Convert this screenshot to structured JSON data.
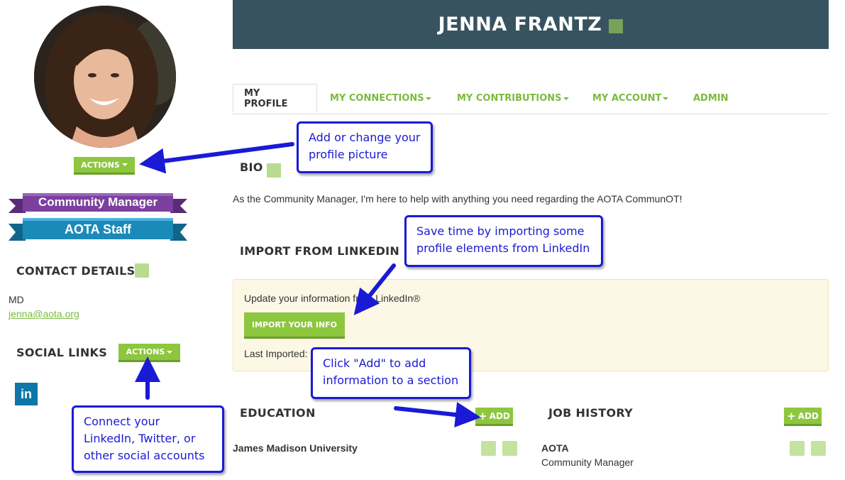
{
  "header": {
    "name": "JENNA FRANTZ"
  },
  "left": {
    "actions_label": "ACTIONS",
    "ribbons": [
      "Community Manager",
      "AOTA Staff"
    ],
    "contact": {
      "heading": "CONTACT DETAILS",
      "degree": "MD",
      "email": "jenna@aota.org"
    },
    "social": {
      "heading": "SOCIAL LINKS",
      "actions_label": "ACTIONS",
      "linkedin_glyph": "in"
    }
  },
  "tabs": [
    {
      "label": "MY PROFILE"
    },
    {
      "label": "MY CONNECTIONS"
    },
    {
      "label": "MY CONTRIBUTIONS"
    },
    {
      "label": "MY ACCOUNT"
    },
    {
      "label": "ADMIN"
    }
  ],
  "bio": {
    "heading": "BIO",
    "text": "As the Community Manager, I'm here to help with anything you need regarding the AOTA CommunOT!"
  },
  "linkedin": {
    "heading": "IMPORT FROM LINKEDIN",
    "intro": "Update your information from LinkedIn®",
    "button": "IMPORT YOUR INFO",
    "last_imported": "Last Imported:"
  },
  "education": {
    "heading": "EDUCATION",
    "add_label": "ADD",
    "school": "James Madison University"
  },
  "jobs": {
    "heading": "JOB HISTORY",
    "add_label": "ADD",
    "org": "AOTA",
    "title": "Community Manager"
  },
  "callouts": {
    "picture": [
      "Add or change your",
      "profile picture"
    ],
    "linkedin": [
      "Save time by importing some",
      "profile elements from LinkedIn"
    ],
    "add": [
      "Click \"Add\" to add",
      "information to a section"
    ],
    "social": [
      "Connect your",
      "LinkedIn, Twitter, or",
      "other social accounts"
    ]
  },
  "colors": {
    "header": "#37535f",
    "accent_green": "#8dc63f",
    "callout_blue": "#1a1ad6",
    "ribbon_purple": "#7b3f9e",
    "ribbon_teal": "#1a8ab8"
  },
  "icons": [
    "pencil-icon",
    "trash-icon",
    "plus-icon",
    "linkedin-icon",
    "chevron-down-icon"
  ]
}
